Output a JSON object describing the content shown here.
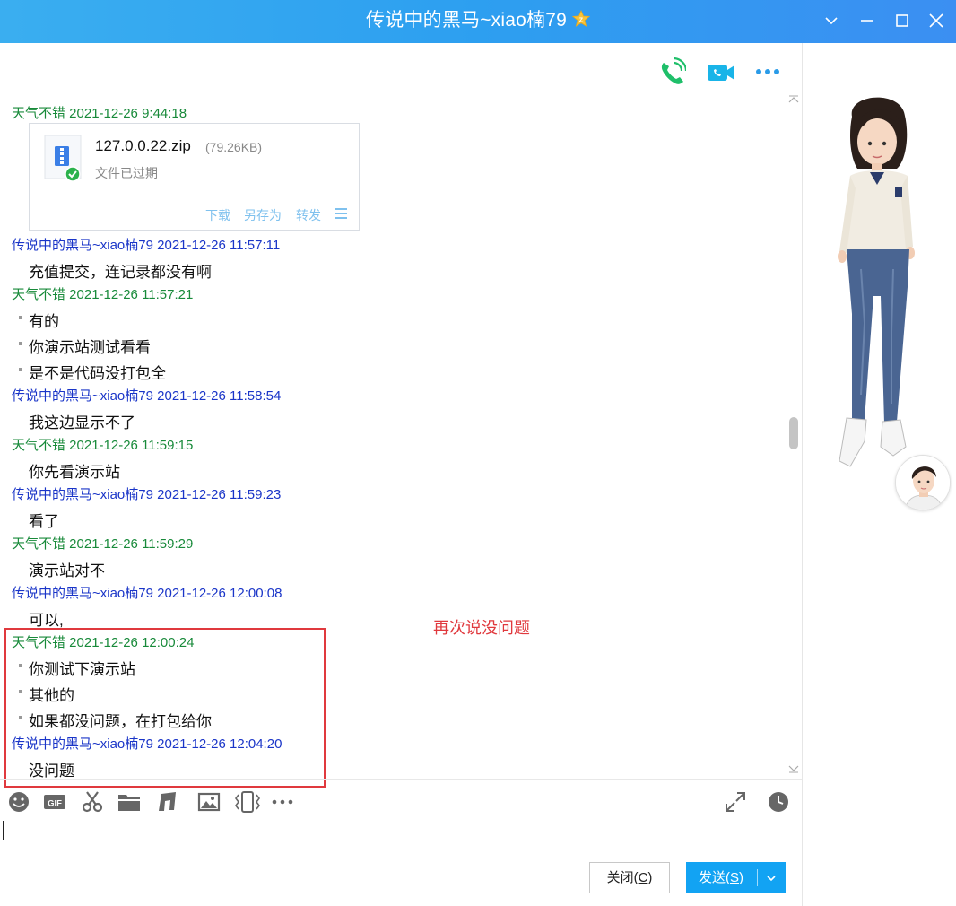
{
  "window": {
    "title": "传说中的黑马~xiao楠79",
    "title_badge": "star-icon"
  },
  "colors": {
    "titlebar": "#2d9ff0",
    "self_name": "#188a3a",
    "peer_name": "#1a35c8",
    "annotation": "#e0393e",
    "send_button": "#12a3f3",
    "file_action": "#7fc1ee"
  },
  "top_actions": [
    "voice-call-icon",
    "video-call-icon",
    "more-icon"
  ],
  "file_message": {
    "header": "天气不错 2021-12-26 9:44:18",
    "file_name": "127.0.0.22.zip",
    "file_size": "(79.26KB)",
    "status": "文件已过期",
    "actions": [
      "下载",
      "另存为",
      "转发"
    ]
  },
  "messages": [
    {
      "header": "传说中的黑马~xiao楠79 2021-12-26 11:57:11",
      "side": "peer",
      "lines": [
        "充值提交，连记录都没有啊"
      ]
    },
    {
      "header": "天气不错 2021-12-26 11:57:21",
      "side": "self",
      "lines": [
        "有的",
        "你演示站测试看看",
        "是不是代码没打包全"
      ]
    },
    {
      "header": "传说中的黑马~xiao楠79 2021-12-26 11:58:54",
      "side": "peer",
      "lines": [
        "我这边显示不了"
      ]
    },
    {
      "header": "天气不错 2021-12-26 11:59:15",
      "side": "self",
      "lines": [
        "你先看演示站"
      ]
    },
    {
      "header": "传说中的黑马~xiao楠79 2021-12-26 11:59:23",
      "side": "peer",
      "lines": [
        "看了"
      ]
    },
    {
      "header": "天气不错 2021-12-26 11:59:29",
      "side": "self",
      "lines": [
        "演示站对不"
      ]
    },
    {
      "header": "传说中的黑马~xiao楠79 2021-12-26 12:00:08",
      "side": "peer",
      "lines": [
        "可以,"
      ]
    },
    {
      "header": "天气不错 2021-12-26 12:00:24",
      "side": "self",
      "lines": [
        "你测试下演示站",
        "其他的",
        "如果都没问题，在打包给你"
      ]
    },
    {
      "header": "传说中的黑马~xiao楠79 2021-12-26 12:04:20",
      "side": "peer",
      "lines": [
        "没问题"
      ]
    }
  ],
  "annotation": {
    "text": "再次说没问题"
  },
  "toolbar": {
    "left_icons": [
      "emoji-icon",
      "gif-icon",
      "scissors-icon",
      "folder-icon",
      "music-icon",
      "image-icon",
      "shake-icon",
      "more-icon"
    ],
    "right_icons": [
      "expand-icon",
      "history-clock-icon"
    ]
  },
  "buttons": {
    "close": "关闭(",
    "close_key": "C",
    "close_end": ")",
    "send": "发送(",
    "send_key": "S",
    "send_end": ")"
  }
}
